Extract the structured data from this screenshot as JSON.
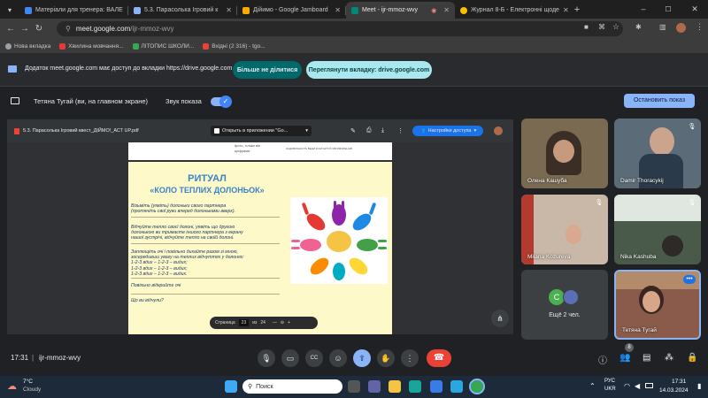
{
  "browser": {
    "tabs": [
      {
        "title": "Матеріали для тренера: ВАЛЕ",
        "color": "#4285f4"
      },
      {
        "title": "5.3. Парасолька Ігровий к",
        "color": "#8ab4f8"
      },
      {
        "title": "Дійимо - Google Jamboard",
        "color": "#f9ab00"
      },
      {
        "title": "Meet - ijr-mmoz-wvy",
        "color": "#00897b"
      },
      {
        "title": "Журнал 8-Б - Електронні щоде",
        "color": "#fbbc04"
      }
    ],
    "new_tab_label": "+",
    "url_host": "meet.google.com",
    "url_path": "/ijr-mmoz-wvy",
    "bookmarks": [
      "Нова вкладка",
      "Хвилина мовчання...",
      "ЛІТОПИС ШКОЛИ...",
      "Вхідні (2 316) - tgo..."
    ]
  },
  "infobar": {
    "message": "Додаток meet.google.com має доступ до вкладки https://drive.google.com",
    "stop_label": "Більше не ділитися",
    "view_label": "Переглянути вкладку: drive.google.com"
  },
  "presenting": {
    "presenter": "Тетяна Тугай (ви, на главном экране)",
    "sound_label": "Звук показа",
    "stop_label": "Остановить показ"
  },
  "pdf": {
    "filename": "5.3. Парасолька Ігровий квест_ДІЙМО!_АСТ UP.pdf",
    "open_in": "Открыть в приложении \"Go...",
    "access_label": "Настройки доступа",
    "title_1": "РИТУАЛ",
    "title_2": "«КОЛО ТЕПЛИХ ДОЛОНЬОК»",
    "p1": "Візьміть (уявіть) долоньки свого партнера\n(протяніть свої руки вперед долоньками вверх).",
    "p2": "Відчуйте тепло своєї долоні, уявіть що другою\nдолонькою ви тримаєте іншого партнера з екрану\nнашої зустрічі, відчуйте тепло на своїй долоні.",
    "p3": "Заплющіть очі і повільно дихайте разом зі мною,\nзосередивши увагу на теплих відчуттях у долонях:\n1-2-3 вдих – 1-2-3 – видих;\n1-2-3 вдих – 1-2-3 – видих;\n1-2-3 вдих – 1-2-3 – видих.",
    "p4": "Повільно відкрийте очі",
    "p5": "Що ви відчули?",
    "prev_text_1": "фото, тільки він",
    "prev_text_2": "цифрами.",
    "prev_text_3": "ЗАДОВІЛЬНІСТЬ ВЕДИ КОНТАКТУЙ ОБГОВОРЕННЯ",
    "page_label": "Страница",
    "page_current": "23",
    "page_of": "из",
    "page_total": "24"
  },
  "participants": [
    {
      "name": "Олена Кашуба",
      "bg": "#7a6a52"
    },
    {
      "name": "Damir Thoracykij",
      "bg": "#5c6b78"
    },
    {
      "name": "Milana Kozureva",
      "bg": "#c9b8a8"
    },
    {
      "name": "Nika Kashuba",
      "bg": "#4a5a4a"
    },
    {
      "name": "Тетяна Тугай",
      "bg": "#8a5a4a"
    }
  ],
  "more_participants": {
    "label": "Ещё 2 чел.",
    "avatar_letter": "C"
  },
  "controls": {
    "time": "17:31",
    "meeting_code": "ijr-mmoz-wvy",
    "badge_count": "8"
  },
  "taskbar": {
    "weather_temp": "7°C",
    "weather_desc": "Cloudy",
    "search_placeholder": "Поиск",
    "lang_1": "РУС",
    "lang_2": "UKR",
    "clock_time": "17:31",
    "clock_date": "14.03.2024"
  }
}
